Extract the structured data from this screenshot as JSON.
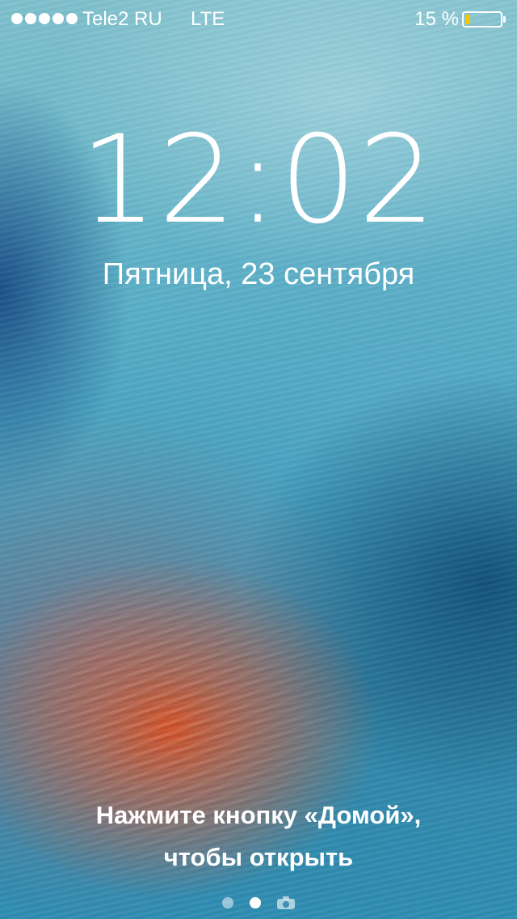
{
  "status_bar": {
    "signal_bars": 5,
    "carrier": "Tele2 RU",
    "network": "LTE",
    "battery_percent": "15 %",
    "battery_level": 0.15,
    "battery_color": "#f6c400"
  },
  "lock_screen": {
    "time": "12:02",
    "date": "Пятница, 23 сентября",
    "unlock_hint_line1": "Нажмите кнопку «Домой»,",
    "unlock_hint_line2": "чтобы открыть"
  },
  "page_indicator": {
    "pages": 2,
    "active_page": 2,
    "extra_icon": "camera-icon"
  }
}
